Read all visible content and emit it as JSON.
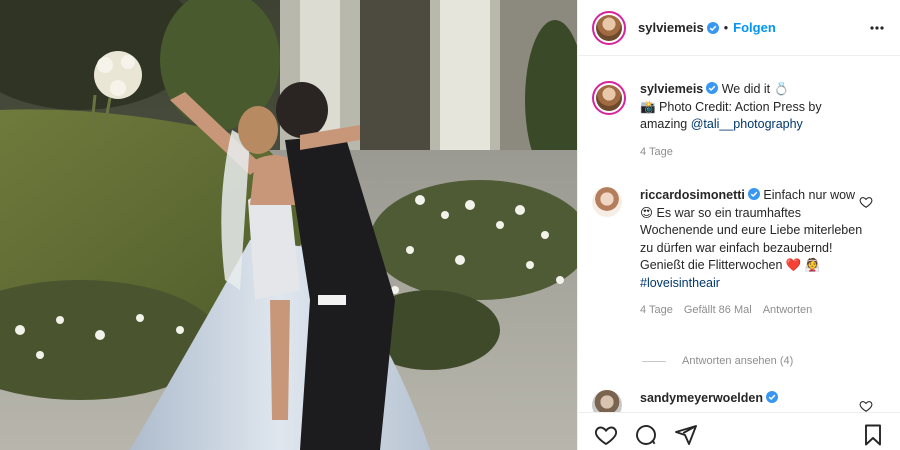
{
  "header": {
    "username": "sylviemeis",
    "separator": "•",
    "follow_label": "Folgen",
    "verified_icon": "verified-badge-icon",
    "more_icon": "more-options-icon"
  },
  "caption": {
    "username": "sylviemeis",
    "text_line1": "We did it 💍",
    "text_line2": "📸 Photo Credit: Action Press by amazing",
    "mention": "@tali__photography",
    "time": "4 Tage"
  },
  "comments": [
    {
      "username": "riccardosimonetti",
      "text": "Einfach nur wow 😍 Es war so ein traumhaftes Wochenende und eure Liebe miterleben zu dürfen war einfach bezaubernd! Genießt die Flitterwochen ❤️ 👰",
      "hashtag": "#loveisintheair",
      "time": "4 Tage",
      "likes": "Gefällt 86 Mal",
      "reply_label": "Antworten",
      "view_replies": "Antworten ansehen (4)"
    },
    {
      "username": "sandymeyerwoelden",
      "text": ""
    }
  ],
  "actions": {
    "like_icon": "heart-icon",
    "comment_icon": "comment-icon",
    "share_icon": "share-icon",
    "save_icon": "bookmark-icon"
  },
  "colors": {
    "accent": "#0095f6",
    "verified": "#3897f0",
    "muted": "#8e8e8e",
    "link": "#00376b"
  }
}
